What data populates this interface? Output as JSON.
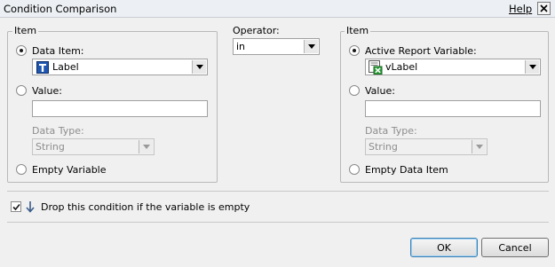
{
  "dialog": {
    "title": "Condition Comparison",
    "help": "Help"
  },
  "left_group": {
    "legend": "Item",
    "data_item_label": "Data Item:",
    "data_item_value": "Label",
    "value_label": "Value:",
    "value_text": "",
    "data_type_label": "Data Type:",
    "data_type_value": "String",
    "empty_label": "Empty Variable"
  },
  "operator": {
    "label": "Operator:",
    "value": "in"
  },
  "right_group": {
    "legend": "Item",
    "variable_label": "Active Report Variable:",
    "variable_value": "vLabel",
    "value_label": "Value:",
    "value_text": "",
    "data_type_label": "Data Type:",
    "data_type_value": "String",
    "empty_label": "Empty Data Item"
  },
  "drop_option": {
    "label": "Drop this condition if the variable is empty",
    "checked": true
  },
  "buttons": {
    "ok": "OK",
    "cancel": "Cancel"
  }
}
